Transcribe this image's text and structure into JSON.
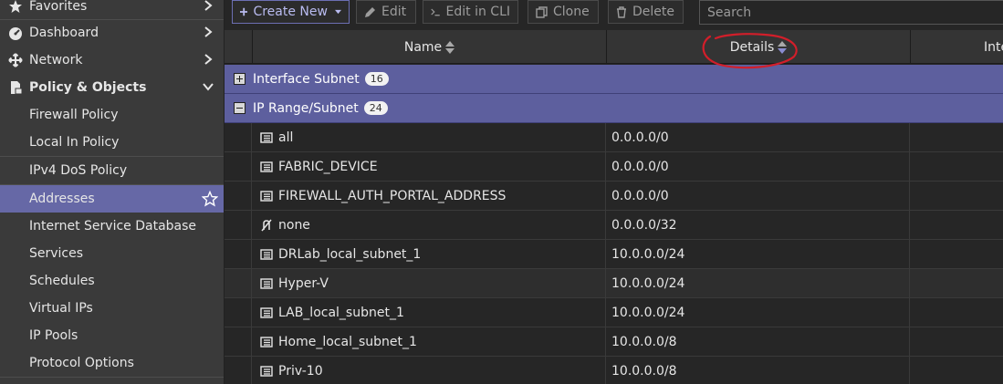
{
  "sidebar": {
    "items": [
      {
        "label": "Favorites",
        "icon": "star-icon"
      },
      {
        "label": "Dashboard",
        "icon": "dashboard-icon"
      },
      {
        "label": "Network",
        "icon": "network-icon"
      },
      {
        "label": "Policy & Objects",
        "icon": "policy-icon"
      },
      {
        "label": "Firewall Policy"
      },
      {
        "label": "Local In Policy"
      },
      {
        "label": "IPv4 DoS Policy"
      },
      {
        "label": "Addresses"
      },
      {
        "label": "Internet Service Database"
      },
      {
        "label": "Services"
      },
      {
        "label": "Schedules"
      },
      {
        "label": "Virtual IPs"
      },
      {
        "label": "IP Pools"
      },
      {
        "label": "Protocol Options"
      }
    ],
    "active": "Addresses"
  },
  "toolbar": {
    "create_new": "Create New",
    "edit": "Edit",
    "edit_cli": "Edit in CLI",
    "clone": "Clone",
    "delete": "Delete",
    "search_placeholder": "Search"
  },
  "table": {
    "columns": [
      "Name",
      "Details",
      "Inte"
    ],
    "groups": [
      {
        "label": "Interface Subnet",
        "count": "16",
        "expanded": false
      },
      {
        "label": "IP Range/Subnet",
        "count": "24",
        "expanded": true
      }
    ],
    "rows": [
      {
        "name": "all",
        "details": "0.0.0.0/0",
        "icon": "address-icon"
      },
      {
        "name": "FABRIC_DEVICE",
        "details": "0.0.0.0/0",
        "icon": "address-icon"
      },
      {
        "name": "FIREWALL_AUTH_PORTAL_ADDRESS",
        "details": "0.0.0.0/0",
        "icon": "address-icon"
      },
      {
        "name": "none",
        "details": "0.0.0.0/32",
        "icon": "none-address-icon"
      },
      {
        "name": "DRLab_local_subnet_1",
        "details": "10.0.0.0/24",
        "icon": "address-icon"
      },
      {
        "name": "Hyper-V",
        "details": "10.0.0.0/24",
        "icon": "address-icon"
      },
      {
        "name": "LAB_local_subnet_1",
        "details": "10.0.0.0/24",
        "icon": "address-icon"
      },
      {
        "name": "Home_local_subnet_1",
        "details": "10.0.0.0/8",
        "icon": "address-icon"
      },
      {
        "name": "Priv-10",
        "details": "10.0.0.0/8",
        "icon": "address-icon"
      }
    ]
  },
  "colors": {
    "accent": "#6668a6",
    "group_header": "#5d5f9e",
    "annotation": "#d21e2a"
  }
}
